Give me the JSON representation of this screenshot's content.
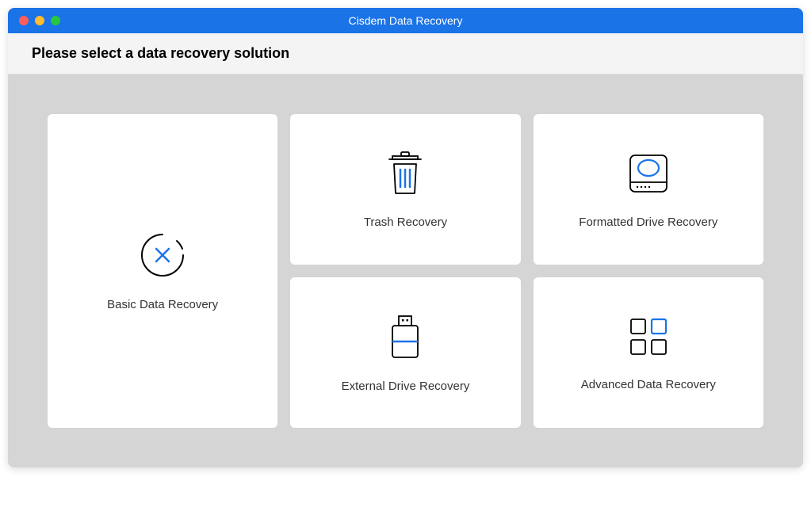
{
  "window": {
    "title": "Cisdem Data Recovery"
  },
  "header": {
    "prompt": "Please select a data recovery solution"
  },
  "cards": {
    "basic": {
      "label": "Basic Data Recovery"
    },
    "trash": {
      "label": "Trash Recovery"
    },
    "formatted": {
      "label": "Formatted Drive Recovery"
    },
    "external": {
      "label": "External Drive Recovery"
    },
    "advanced": {
      "label": "Advanced Data Recovery"
    }
  }
}
